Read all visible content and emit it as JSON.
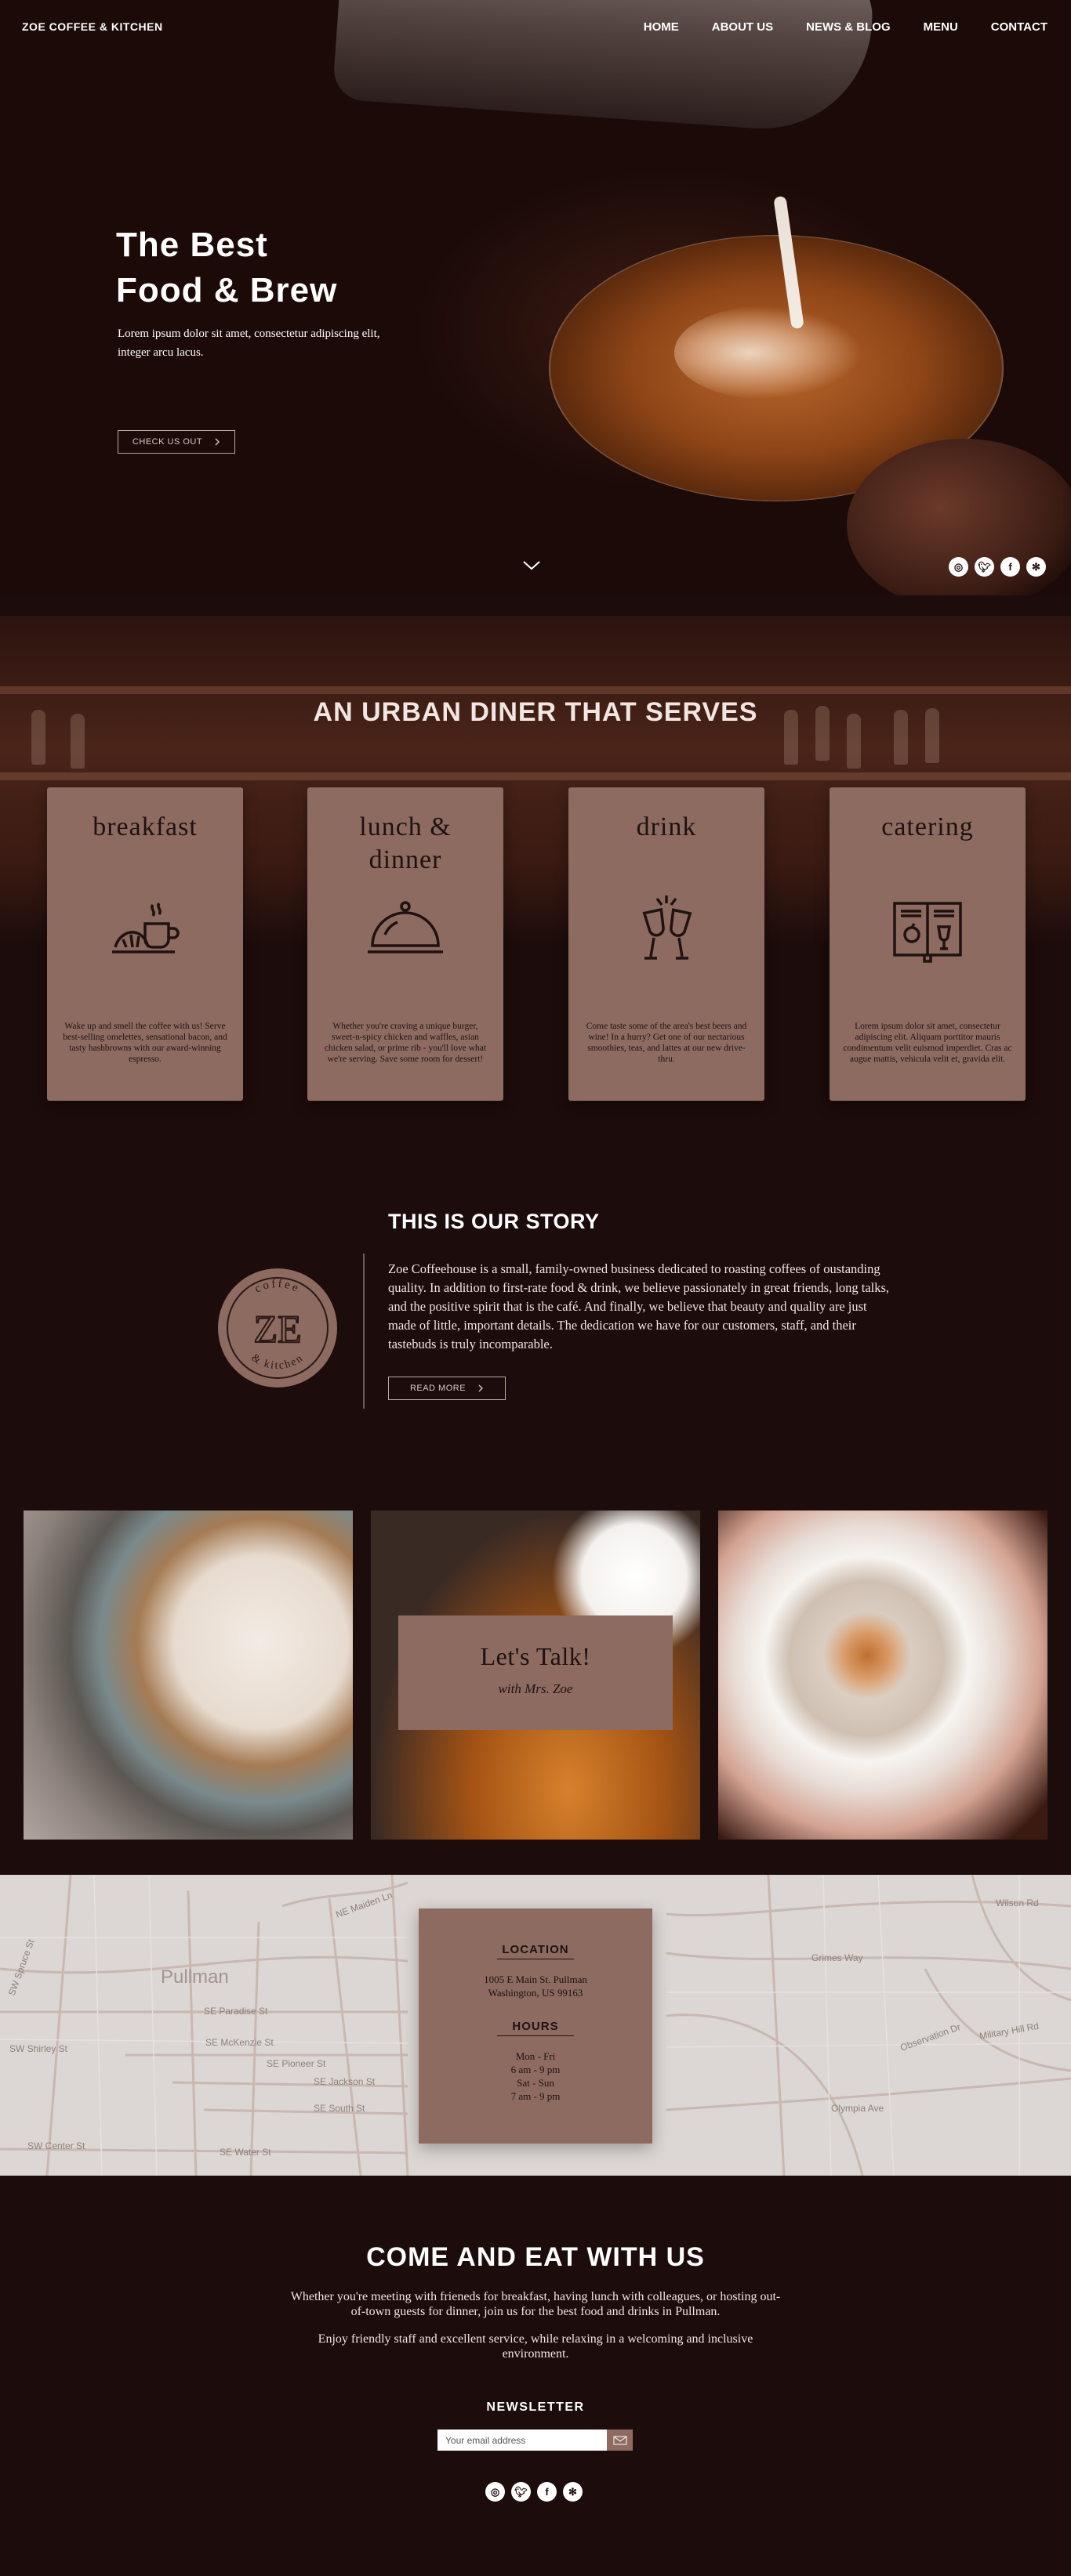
{
  "nav": {
    "brand": "ZOE COFFEE & KITCHEN",
    "links": [
      "HOME",
      "ABOUT US",
      "NEWS & BLOG",
      "MENU",
      "CONTACT"
    ]
  },
  "hero": {
    "title_line1": "The Best",
    "title_line2": "Food & Brew",
    "subtitle": "Lorem ipsum dolor sit amet, consectetur adipiscing elit, integer arcu lacus.",
    "button": "CHECK US OUT"
  },
  "social_icons": [
    "instagram-icon",
    "twitter-icon",
    "facebook-icon",
    "yelp-icon"
  ],
  "serves": {
    "title": "AN URBAN DINER THAT SERVES",
    "cards": [
      {
        "title": "breakfast",
        "icon": "breakfast-icon",
        "text": "Wake up and smell the coffee with us! Serve best-selling omelettes, sensational bacon, and tasty hashbrowns with our award-winning espresso."
      },
      {
        "title": "lunch & dinner",
        "icon": "cloche-icon",
        "text": "Whether you're craving a unique burger, sweet-n-spicy chicken and waffles, asian chicken salad, or prime rib - you'll love what we're serving. Save some room for dessert!"
      },
      {
        "title": "drink",
        "icon": "wine-glasses-icon",
        "text": "Come taste some of the area's best beers and wine! In a hurry? Get one of our nectarious smoothies, teas, and lattes at our new drive-thru."
      },
      {
        "title": "catering",
        "icon": "menu-book-icon",
        "text": "Lorem ipsum dolor sit amet, consectetur adipiscing elit. Aliquam porttitor mauris condimentum velit euismod imperdiet. Cras ac augue mattis, vehicula velit et, gravida elit."
      }
    ]
  },
  "story": {
    "title": "THIS IS OUR STORY",
    "text": "Zoe Coffeehouse is a small, family-owned business dedicated to roasting coffees of oustanding quality. In addition to first-rate food & drink, we believe passionately in great friends, long talks, and the positive spirit that is the café. And finally, we believe that beauty and quality are just made of little, important details. The dedication we have for our customers, staff, and their tastebuds is truly incomparable.",
    "button": "READ MORE",
    "seal_top": "coffee",
    "seal_bottom": "& kitchen",
    "seal_mark": "ZE"
  },
  "talk": {
    "title": "Let's Talk!",
    "subtitle": "with Mrs. Zoe"
  },
  "map": {
    "labels": [
      "Pullman",
      "SW Spruce St",
      "SW Shirley St",
      "SE Paradise St",
      "SE McKenzie St",
      "SE Pioneer St",
      "SE Jackson St",
      "SE South St",
      "SW Center St",
      "SE Water St",
      "Grimes Way",
      "Olympia Ave",
      "Wilson Rd",
      "NE Maiden Ln",
      "Observation Dr",
      "Military Hill Rd"
    ],
    "location_heading": "LOCATION",
    "address_line1": "1005 E Main St. Pullman",
    "address_line2": "Washington, US 99163",
    "hours_heading": "HOURS",
    "hours": [
      "Mon - Fri",
      "6 am - 9 pm",
      "Sat - Sun",
      "7 am - 9 pm"
    ]
  },
  "footer": {
    "title": "COME AND EAT WITH US",
    "para1": "Whether you're meeting with frieneds for breakfast, having lunch with colleagues, or hosting out-of-town guests for dinner, join us for the best food and drinks in Pullman.",
    "para2": "Enjoy friendly staff and excellent service, while relaxing in a welcoming and inclusive environment.",
    "newsletter": "NEWSLETTER",
    "email_placeholder": "Your email address"
  },
  "colors": {
    "background": "#1c0c0b",
    "card": "#8d6b61",
    "map": "#dcd7d4"
  }
}
